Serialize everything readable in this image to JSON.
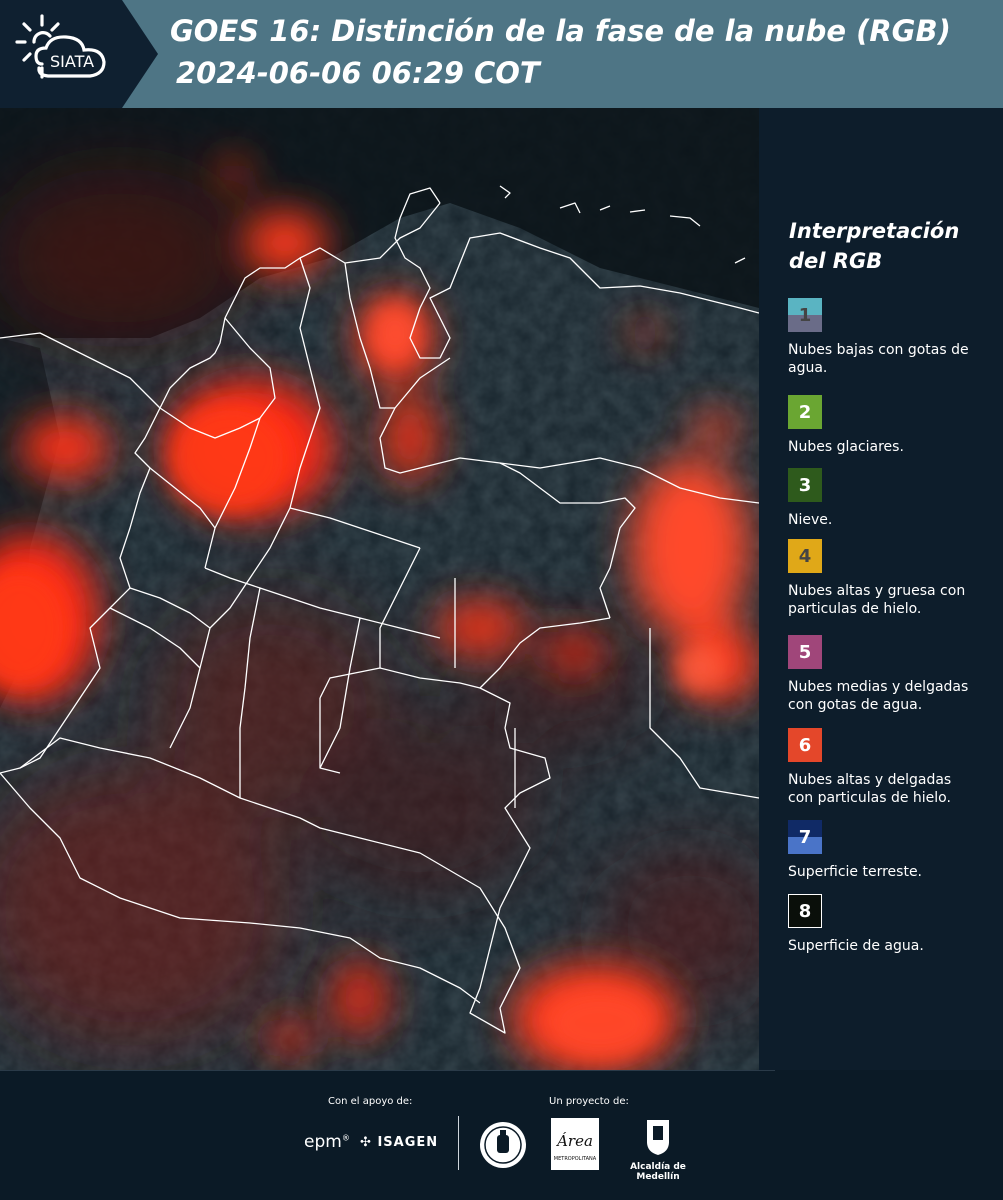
{
  "header": {
    "logo_text": "SIATA",
    "title_line1": "GOES 16: Distinción de la fase de la nube (RGB)",
    "title_line2": "2024-06-06 06:29 COT"
  },
  "legend": {
    "title": "Interpretación del RGB",
    "items": [
      {
        "num": "1",
        "label": "Nubes bajas con gotas de agua.",
        "color_top": "#5ab4c2",
        "color_bottom": "#6a6c88",
        "num_color": "#444444"
      },
      {
        "num": "2",
        "label": "Nubes glaciares.",
        "color_top": "#6aa632",
        "color_bottom": "#6aa632",
        "num_color": "#ffffff"
      },
      {
        "num": "3",
        "label": "Nieve.",
        "color_top": "#2e5a1c",
        "color_bottom": "#2e5a1c",
        "num_color": "#ffffff"
      },
      {
        "num": "4",
        "label": "Nubes altas y gruesa con particulas de hielo.",
        "color_top": "#e0a818",
        "color_bottom": "#e0a818",
        "num_color": "#444444"
      },
      {
        "num": "5",
        "label": "Nubes medias y delgadas con gotas de agua.",
        "color_top": "#a0467a",
        "color_bottom": "#a0467a",
        "num_color": "#ffffff"
      },
      {
        "num": "6",
        "label": "Nubes altas y delgadas con particulas de hielo.",
        "color_top": "#e4472a",
        "color_bottom": "#e4472a",
        "num_color": "#ffffff"
      },
      {
        "num": "7",
        "label": "Superficie terreste.",
        "color_top": "#102a66",
        "color_bottom": "#4a74c8",
        "num_color": "#ffffff"
      },
      {
        "num": "8",
        "label": "Superficie de agua.",
        "color_top": "#0a0f0a",
        "color_bottom": "#0a0f0a",
        "num_color": "#ffffff"
      }
    ]
  },
  "footer": {
    "support_label": "Con el apoyo de:",
    "project_label": "Un proyecto de:",
    "epm": "epm",
    "isagen": "ISAGEN",
    "area_text": "Área",
    "area_sub": "METROPOLITANA",
    "alcaldia": "Alcaldía de Medellín"
  },
  "colors": {
    "header_bg": "#4e7585",
    "logo_bg": "#0f2030",
    "panel_bg": "#0d1d2b",
    "cloud_red": "#ff2a12",
    "land": "#1b2a32"
  }
}
